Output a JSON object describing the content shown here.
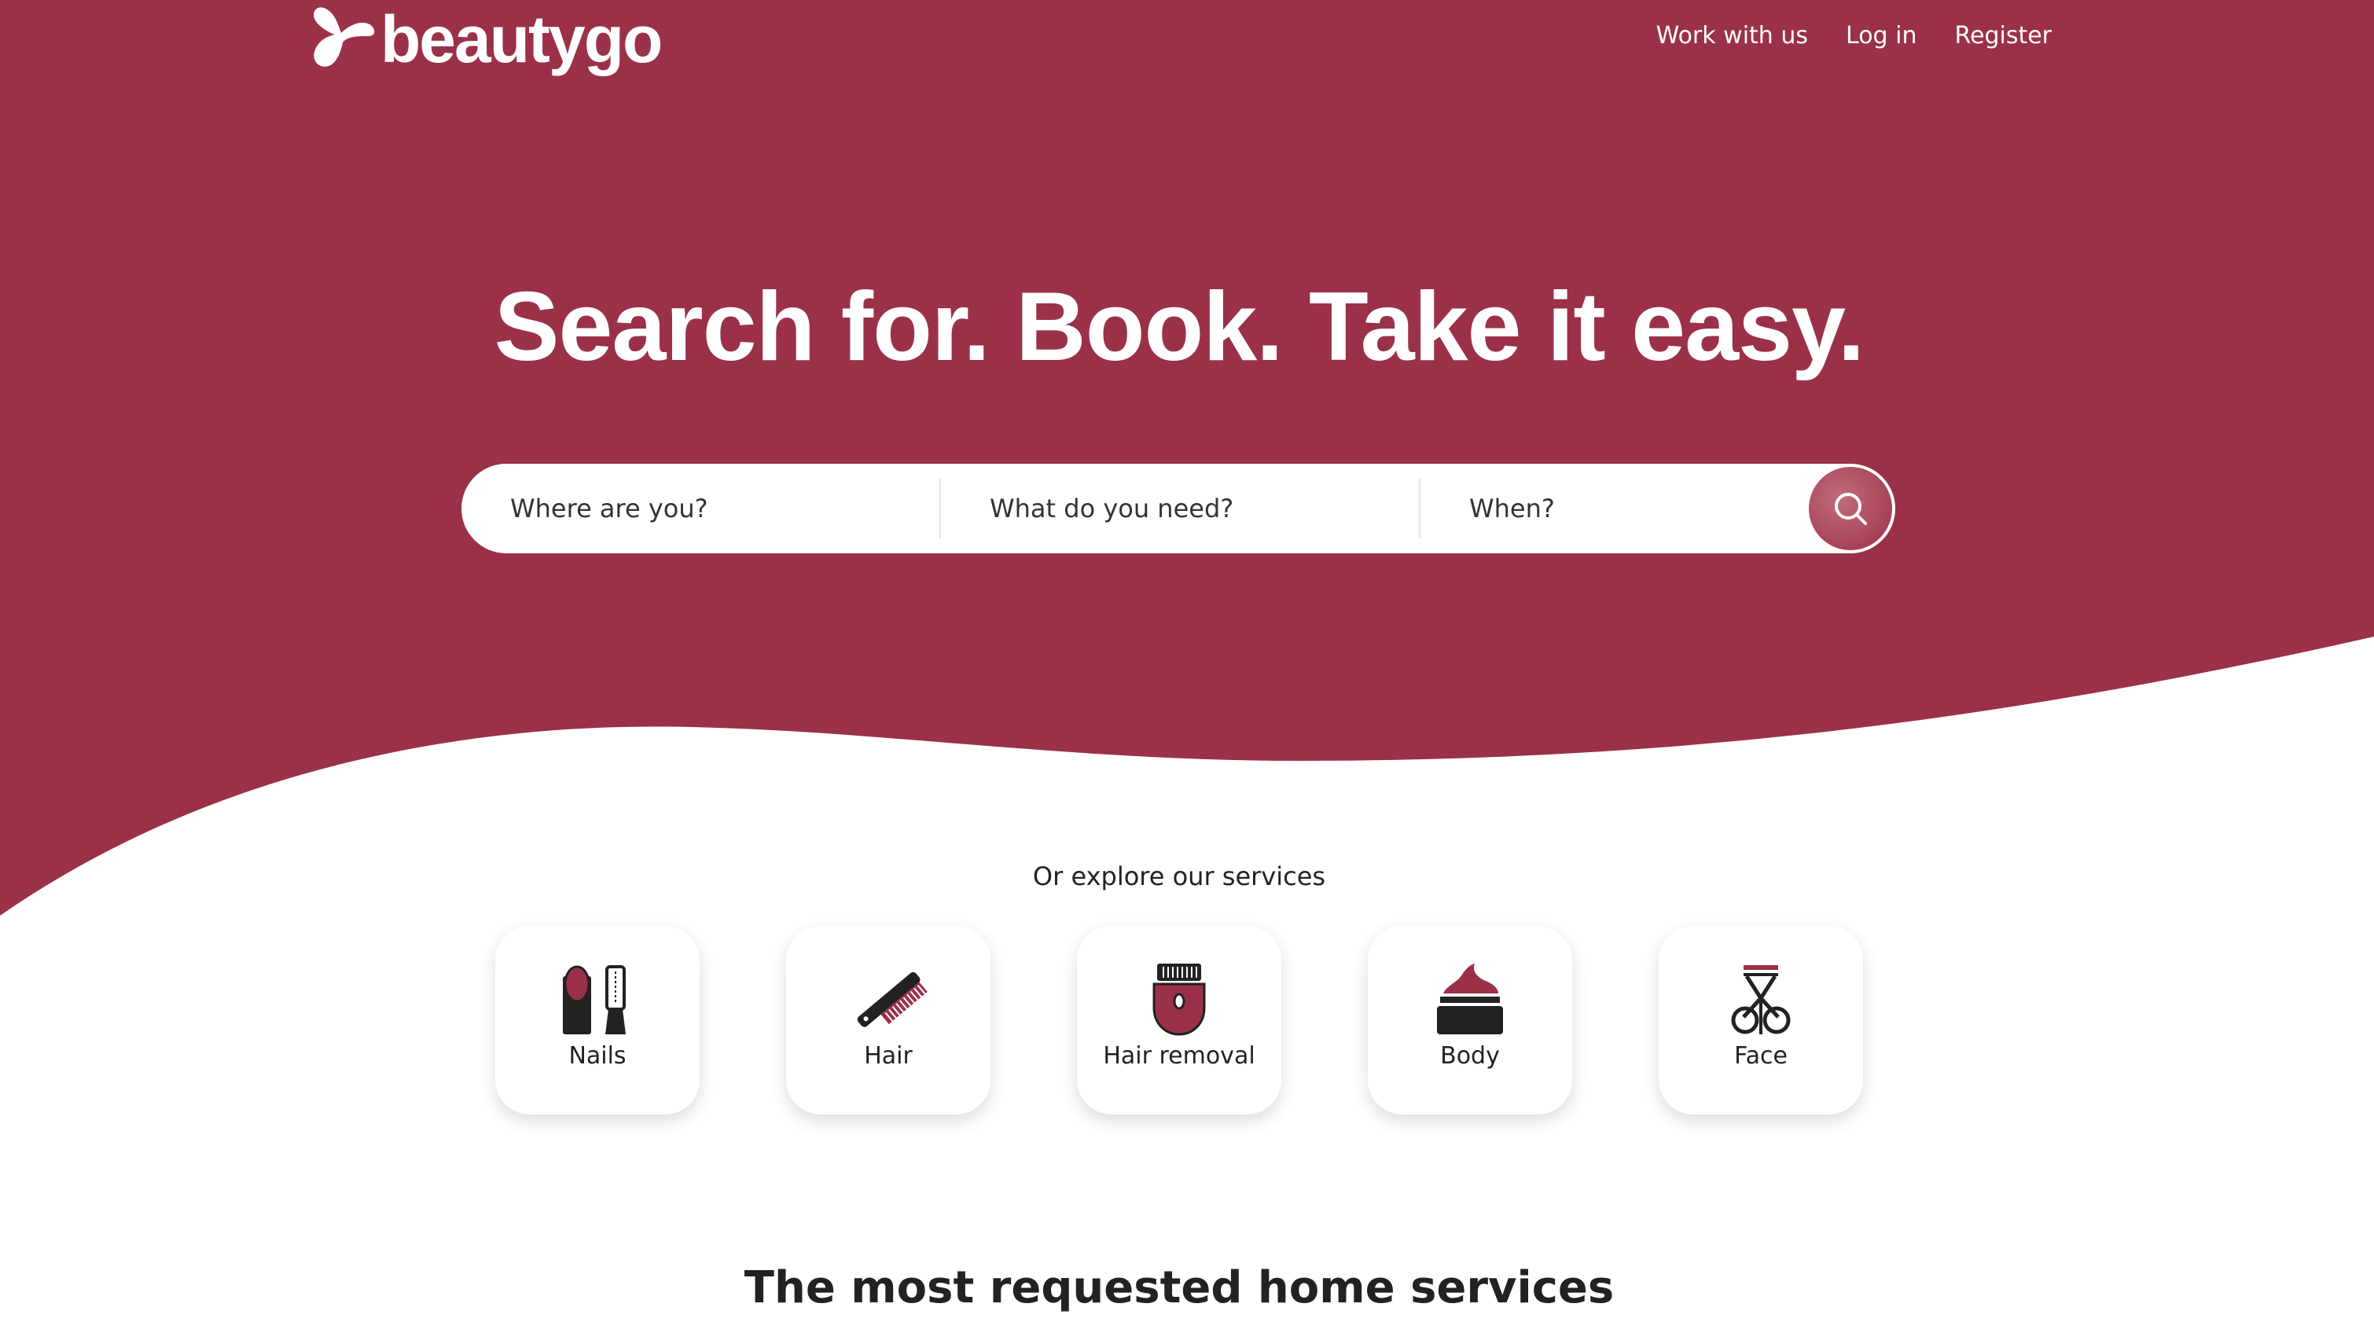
{
  "brand": {
    "name": "beautygo",
    "color": "#9b3148"
  },
  "nav": {
    "work": "Work with us",
    "login": "Log in",
    "register": "Register"
  },
  "hero": {
    "headline": "Search for. Book. Take it easy."
  },
  "search": {
    "where": "Where are you?",
    "what": "What do you need?",
    "when": "When?",
    "button_icon": "search-icon"
  },
  "explore": {
    "title": "Or explore our services",
    "items": [
      {
        "label": "Nails",
        "icon": "nails-icon"
      },
      {
        "label": "Hair",
        "icon": "comb-icon"
      },
      {
        "label": "Hair removal",
        "icon": "epilator-icon"
      },
      {
        "label": "Body",
        "icon": "cream-jar-icon"
      },
      {
        "label": "Face",
        "icon": "eyelash-curler-icon"
      }
    ]
  },
  "section": {
    "title": "The most requested home services"
  }
}
